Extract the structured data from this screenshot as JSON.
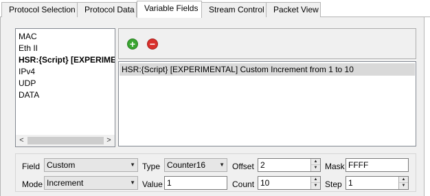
{
  "tabs": [
    {
      "label": "Protocol Selection"
    },
    {
      "label": "Protocol Data"
    },
    {
      "label": "Variable Fields",
      "active": true
    },
    {
      "label": "Stream Control"
    },
    {
      "label": "Packet View"
    }
  ],
  "protocols": [
    {
      "label": "MAC"
    },
    {
      "label": "Eth II"
    },
    {
      "label": "HSR:{Script} [EXPERIMENTAL]",
      "selected": true
    },
    {
      "label": "IPv4"
    },
    {
      "label": "UDP"
    },
    {
      "label": "DATA"
    }
  ],
  "scrollbar": {
    "left_icon": "<",
    "right_icon": ">"
  },
  "toolbar": {
    "add_icon": "+",
    "remove_icon": "−",
    "add_color": "#3aa531",
    "remove_color": "#d9302c"
  },
  "variable_fields": [
    {
      "label": "HSR:{Script} [EXPERIMENTAL] Custom Increment from 1 to 10"
    }
  ],
  "form": {
    "field": {
      "label": "Field",
      "value": "Custom"
    },
    "type": {
      "label": "Type",
      "value": "Counter16"
    },
    "offset": {
      "label": "Offset",
      "value": "2"
    },
    "mask": {
      "label": "Mask",
      "value": "FFFF"
    },
    "mode": {
      "label": "Mode",
      "value": "Increment"
    },
    "val": {
      "label": "Value",
      "value": "1"
    },
    "count": {
      "label": "Count",
      "value": "10"
    },
    "step": {
      "label": "Step",
      "value": "1"
    }
  }
}
